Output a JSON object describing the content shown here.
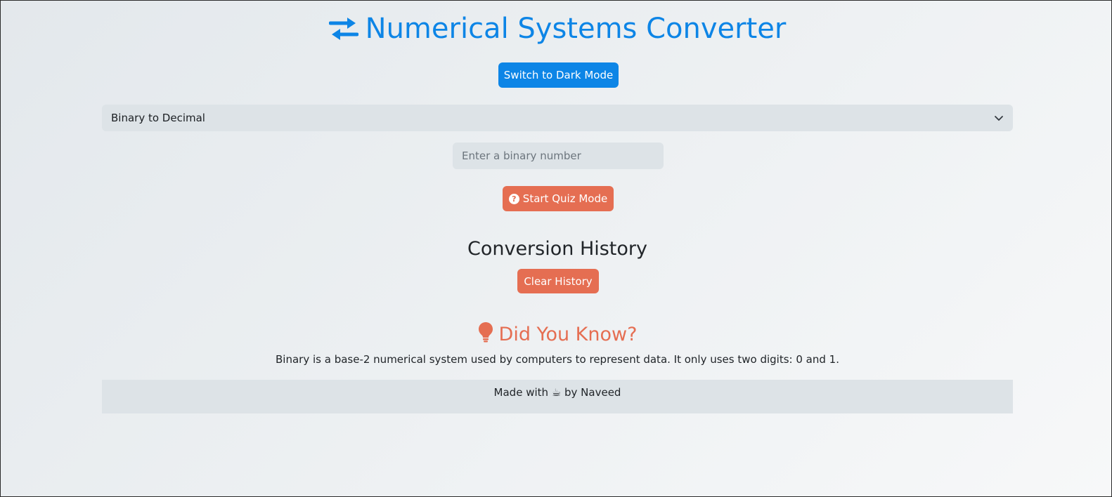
{
  "header": {
    "title": "Numerical Systems Converter",
    "title_icon": "exchange-arrows-icon",
    "theme_toggle_label": "Switch to Dark Mode"
  },
  "converter": {
    "mode_select": {
      "selected": "Binary to Decimal"
    },
    "input": {
      "value": "",
      "placeholder": "Enter a binary number"
    },
    "quiz_button_label": "Start Quiz Mode",
    "quiz_icon": "question-circle-icon"
  },
  "history": {
    "title": "Conversion History",
    "clear_label": "Clear History"
  },
  "did_you_know": {
    "icon": "lightbulb-icon",
    "title": "Did You Know?",
    "text": "Binary is a base-2 numerical system used by computers to represent data. It only uses two digits: 0 and 1."
  },
  "footer": {
    "text": "Made with ☕ by Naveed"
  },
  "colors": {
    "primary": "#0d85e6",
    "accent": "#e56e52",
    "panel": "#dde3e7"
  }
}
